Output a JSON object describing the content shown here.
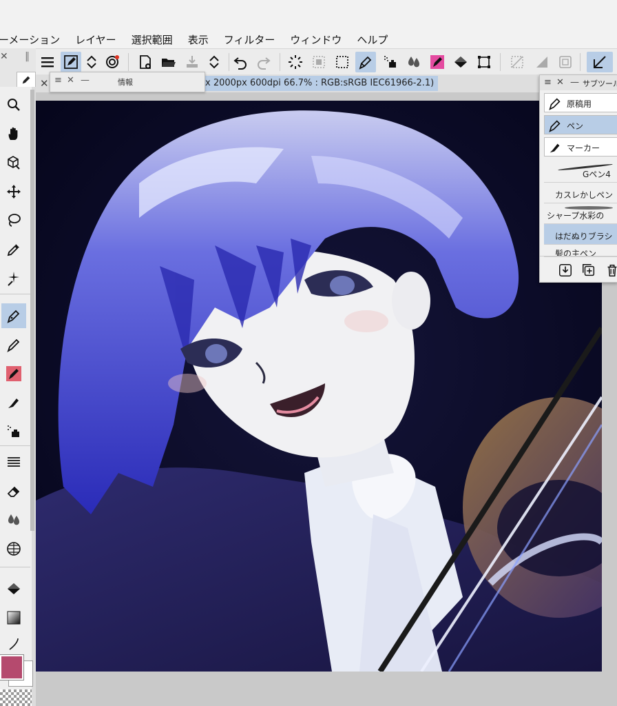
{
  "menu": {
    "items": [
      "ーメーション",
      "レイヤー",
      "選択範囲",
      "表示",
      "フィルター",
      "ウィンドウ",
      "ヘルプ"
    ]
  },
  "document": {
    "tab_label": "x 2000px 600dpi 66.7% : RGB:sRGB IEC61966-2.1)"
  },
  "info_panel": {
    "title": "情報"
  },
  "sub_tool": {
    "title": "サブツール",
    "groups": [
      "原稿用",
      "ペン",
      "マーカー"
    ],
    "active_group": "ペン",
    "brushes": [
      "Gペン4",
      "カスレかしペン",
      "シャープ水彩の",
      "はだぬりブラシ",
      "髪の主ペン"
    ],
    "active_brush": "はだぬりブラシ"
  },
  "colors": {
    "main": "#b54a6e",
    "sub": "#ffffff",
    "accent": "#b8cde6"
  }
}
